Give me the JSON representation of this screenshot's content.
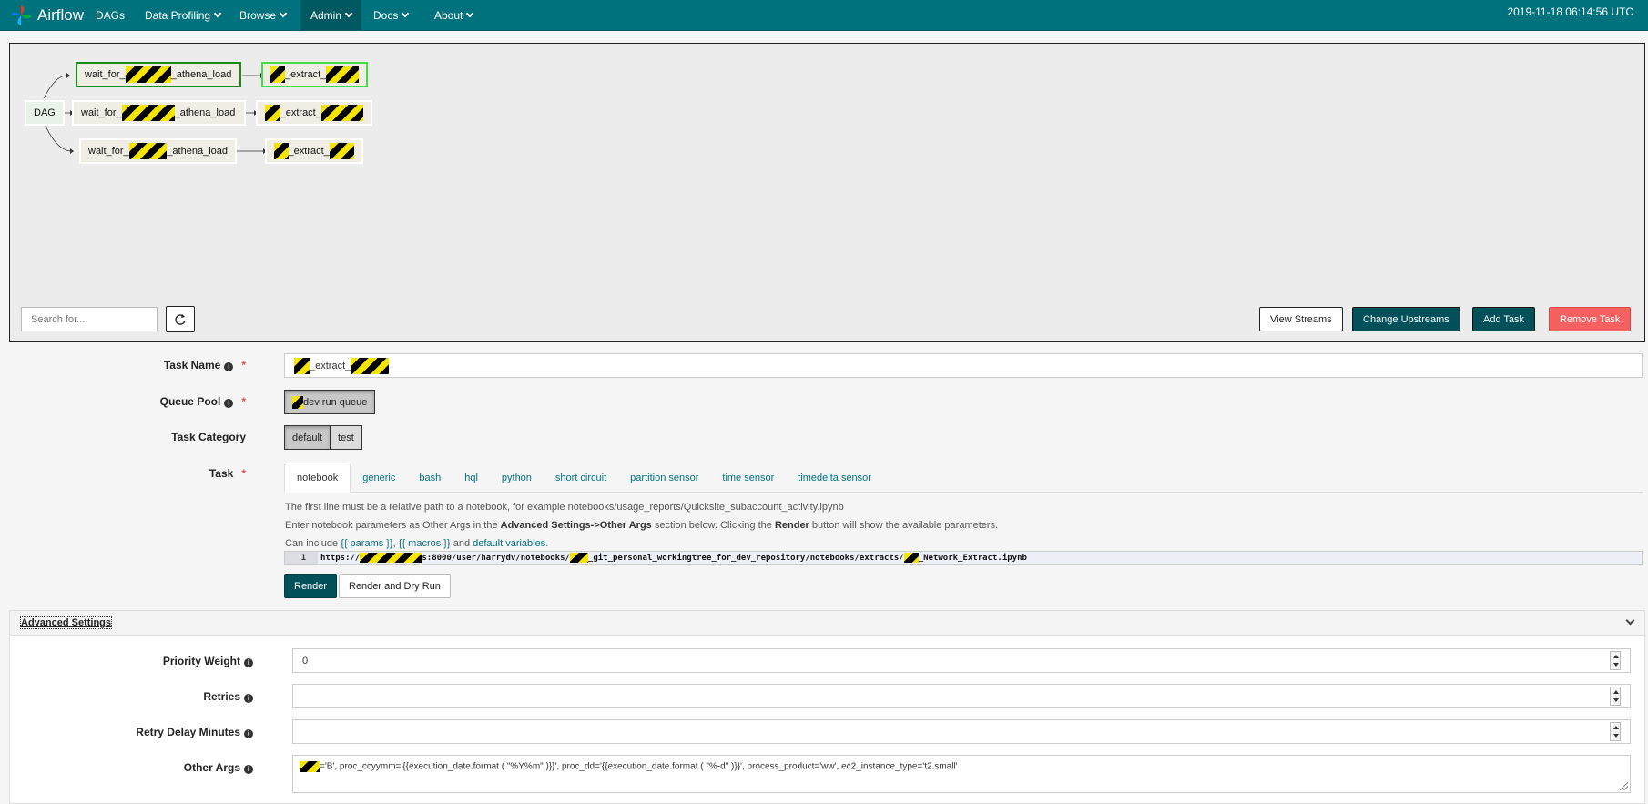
{
  "nav": {
    "brand": "Airflow",
    "items": [
      {
        "label": "DAGs"
      },
      {
        "label": "Data Profiling"
      },
      {
        "label": "Browse"
      },
      {
        "label": "Admin"
      },
      {
        "label": "Docs"
      },
      {
        "label": "About"
      }
    ],
    "timestamp": "2019-11-18 06:14:56 UTC"
  },
  "graph": {
    "dag_label": "DAG",
    "nodes": [
      {
        "pre": "wait_for_",
        "post": "_athena_load",
        "state": "success"
      },
      {
        "pre": "",
        "post": "_extract_",
        "state": "running"
      },
      {
        "pre": "wait_for_",
        "post": "_athena_load",
        "state": "none"
      },
      {
        "pre": "",
        "post": "_extract_",
        "state": "none"
      },
      {
        "pre": "wait_for_",
        "post": "_athena_load",
        "state": "none"
      },
      {
        "pre": "",
        "post": "_extract_",
        "state": "none"
      }
    ],
    "search_placeholder": "Search for...",
    "buttons": {
      "view_streams": "View Streams",
      "change_upstreams": "Change Upstreams",
      "add_task": "Add Task",
      "remove_task": "Remove Task"
    }
  },
  "form": {
    "task_name": {
      "label": "Task Name",
      "value": "_extract_"
    },
    "queue_pool": {
      "label": "Queue Pool",
      "value": "dev run queue"
    },
    "task_category": {
      "label": "Task Category",
      "options": [
        "default",
        "test"
      ],
      "selected": "default"
    },
    "task": {
      "label": "Task",
      "tabs": [
        "notebook",
        "generic",
        "bash",
        "hql",
        "python",
        "short circuit",
        "partition sensor",
        "time sensor",
        "timedelta sensor"
      ],
      "active_tab": "notebook"
    },
    "help": {
      "line1": "The first line must be a relative path to a notebook, for example notebooks/usage_reports/Quicksite_subaccount_activity.ipynb",
      "line2_pre": "Enter notebook parameters as Other Args in the ",
      "line2_bold1": "Advanced Settings->Other Args",
      "line2_mid": " section below. Clicking the ",
      "line2_bold2": "Render",
      "line2_post": " button will show the available parameters.",
      "line3_pre": "Can include ",
      "line3_link1": "{{ params }}",
      "line3_sep": ", ",
      "line3_link2": "{{ macros }}",
      "line3_and": " and ",
      "line3_link3": "default variables",
      "line3_end": "."
    },
    "code": {
      "line_number": "1",
      "part1": "https://",
      "part2": "s:8000/user/harrydv/notebooks/",
      "part3": "_git_personal_workingtree_for_dev_repository/notebooks/extracts/",
      "part4": "_Network_Extract.ipynb"
    },
    "render_label": "Render",
    "render_dry_label": "Render and Dry Run"
  },
  "advanced": {
    "title": "Advanced Settings",
    "priority_weight": {
      "label": "Priority Weight",
      "value": "0"
    },
    "retries": {
      "label": "Retries",
      "value": ""
    },
    "retry_delay": {
      "label": "Retry Delay Minutes",
      "value": ""
    },
    "other_args": {
      "label": "Other Args",
      "value": "='B', proc_ccyymm='{{execution_date.format ( \"%Y%m\" )}}', proc_dd='{{execution_date.format ( \"%-d\" )}}', process_product='ww', ec2_instance_type='t2.small'"
    }
  },
  "colors": {
    "navbar": "#00727d",
    "accent_teal": "#00505a",
    "danger": "#f56161",
    "success_border": "#1a8a1a",
    "running_border": "#44dd44"
  }
}
